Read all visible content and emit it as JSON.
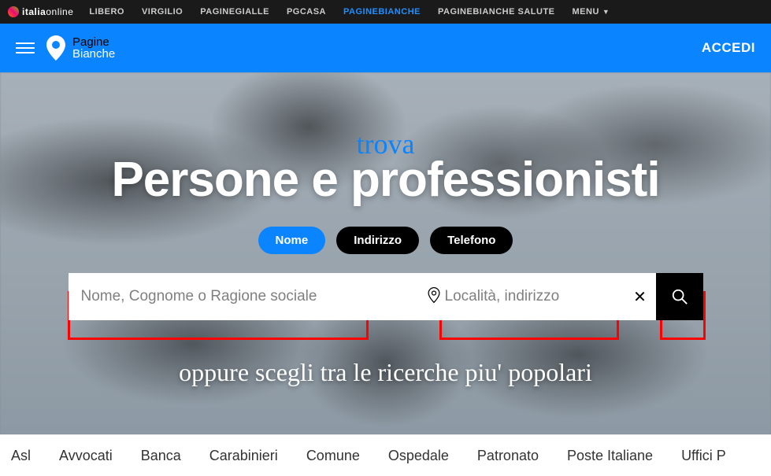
{
  "topbar": {
    "logo_text_bold": "italia",
    "logo_text_thin": "online",
    "items": [
      {
        "label": "LIBERO",
        "active": false
      },
      {
        "label": "VIRGILIO",
        "active": false
      },
      {
        "label": "PAGINEGIALLE",
        "active": false
      },
      {
        "label": "PGCASA",
        "active": false
      },
      {
        "label": "PAGINEBIANCHE",
        "active": true
      },
      {
        "label": "PAGINEBIANCHE SALUTE",
        "active": false
      }
    ],
    "menu_label": "MENU"
  },
  "header": {
    "logo_line1": "Pagine",
    "logo_line2": "Bianche",
    "accedi": "ACCEDI"
  },
  "hero": {
    "script_top": "trova",
    "title": "Persone e professionisti",
    "tabs": [
      {
        "label": "Nome",
        "active": true
      },
      {
        "label": "Indirizzo",
        "active": false
      },
      {
        "label": "Telefono",
        "active": false
      }
    ],
    "search_name_placeholder": "Nome, Cognome o Ragione sociale",
    "search_loc_placeholder": "Località, indirizzo",
    "script_bottom": "oppure scegli tra le ricerche piu' popolari"
  },
  "popular": {
    "items": [
      "Asl",
      "Avvocati",
      "Banca",
      "Carabinieri",
      "Comune",
      "Ospedale",
      "Patronato",
      "Poste Italiane",
      "Uffici P"
    ]
  }
}
